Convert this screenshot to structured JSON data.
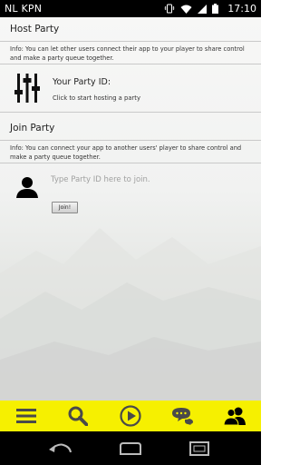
{
  "status_bar": {
    "carrier": "NL KPN",
    "time": "17:10"
  },
  "host": {
    "heading": "Host Party",
    "info": "Info: You can let other users connect their app to your player to share control and make a party queue together.",
    "party_id_label": "Your Party ID:",
    "start_hint": "Click to start hosting a party"
  },
  "join": {
    "heading": "Join Party",
    "info": "Info: You can connect your app to another users' player to share control and make a party queue together.",
    "placeholder": "Type Party ID here to join.",
    "button_label": "Join!"
  },
  "bottom_nav": {
    "items": [
      "menu-icon",
      "search-icon",
      "play-icon",
      "chat-icon",
      "party-icon"
    ],
    "active": "party-icon"
  },
  "colors": {
    "nav_background": "#f6f000",
    "icon_color": "#4a4a4a",
    "active_icon": "#000000"
  }
}
